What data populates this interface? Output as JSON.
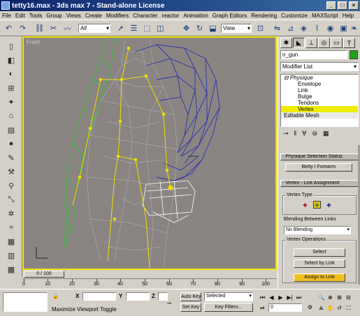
{
  "window": {
    "title": "tetty16.max - 3ds max 7 - Stand-alone License",
    "buttons": [
      "_",
      "□",
      "×"
    ]
  },
  "menu": [
    "File",
    "Edit",
    "Tools",
    "Group",
    "Views",
    "Create",
    "Modifiers",
    "Character",
    "reactor",
    "Animation",
    "Graph Editors",
    "Rendering",
    "Customize",
    "MAXScript",
    "Help"
  ],
  "toolbar": {
    "selection_filter": "All",
    "ref_coord": "View"
  },
  "viewport": {
    "label": "Front",
    "border_color": "#f5e400",
    "background": "#8a8582"
  },
  "timeline": {
    "frame_display": "0 / 100",
    "ticks": [
      "0",
      "10",
      "20",
      "30",
      "40",
      "50",
      "60",
      "70",
      "80",
      "90",
      "100"
    ]
  },
  "command_panel": {
    "object_name": "n_gun",
    "object_color": "#1fa31f",
    "modifier_list": "Modifier List",
    "stack": [
      {
        "label": "⊟ Physique",
        "indent": 0,
        "italic": true
      },
      {
        "label": "Envelope",
        "indent": 1
      },
      {
        "label": "Link",
        "indent": 1
      },
      {
        "label": "Bulge",
        "indent": 1
      },
      {
        "label": "Tendons",
        "indent": 1
      },
      {
        "label": "Vertex",
        "indent": 1,
        "selected": true
      },
      {
        "label": "Editable Mesh",
        "indent": 0
      }
    ],
    "rollout_selection_status": "- Physique Selection Status",
    "selection_status_value": "Betty I Forearm",
    "rollout_vertex_link": "- Vertex - Link Assignment",
    "vertex_type_label": "Vertex Type",
    "blending_label": "Blending Between Links",
    "blending_value": "No Blending",
    "vertex_operations_label": "Vertex Operations",
    "buttons": {
      "select": "Select",
      "select_by_link": "Select by Link",
      "assign_to_link": "Assign to Link"
    }
  },
  "statusbar": {
    "x_label": "X",
    "y_label": "Y",
    "z_label": "Z",
    "auto_key": "Auto Key",
    "set_key": "Set Key",
    "key_mode_value": "Selected",
    "key_filters": "Key Filters...",
    "frame_value": "0",
    "prompt": "Maximize Viewport Toggle"
  }
}
